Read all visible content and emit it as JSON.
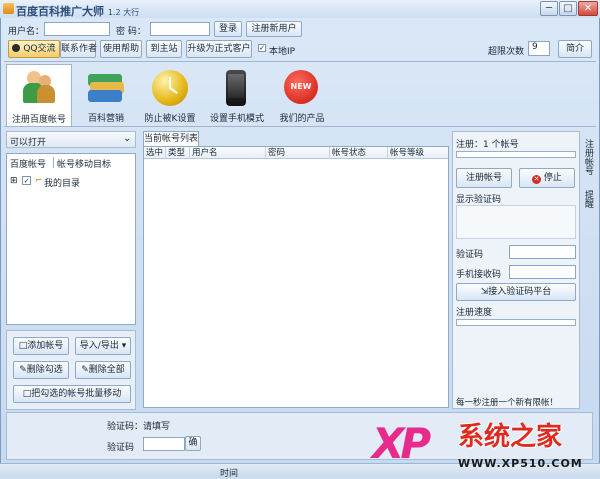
{
  "window": {
    "title": "百度百科推广大师",
    "version": "1.2 大行",
    "buttons": {
      "minimize": "─",
      "maximize": "□",
      "close": "✕"
    }
  },
  "login": {
    "username_label": "用户名：",
    "password_label": "密  码：",
    "login_button": "登录",
    "register_button": "注册新用户"
  },
  "toolbar": {
    "qq_button": "QQ交流",
    "contact_button": "联系作者",
    "help_button": "使用帮助",
    "forum_button": "到主站",
    "upgrade_button": "升级为正式客户",
    "local_checkbox": "本地IP",
    "retry_label": "超限次数",
    "retry_value": "9",
    "about_button": "简介"
  },
  "main_tabs": [
    {
      "label": "注册百度帐号",
      "icon": "user-icon"
    },
    {
      "label": "百科营销",
      "icon": "cards-icon"
    },
    {
      "label": "防止被K设置",
      "icon": "clock-icon"
    },
    {
      "label": "设置手机模式",
      "icon": "phone-icon"
    },
    {
      "label": "我们的产品",
      "icon": "new-badge-icon"
    }
  ],
  "left_panel": {
    "dropdown_value": "可以打开",
    "tab_baidu": "百度帐号",
    "tab_other": "帐号移动目标",
    "tree_root": "我的目录",
    "buttons": {
      "add": "添加帐号",
      "import": "导入/导出",
      "delete_checked": "删除勾选",
      "delete_all": "删除全部",
      "move_checked": "把勾选的帐号批量移动"
    }
  },
  "center_panel": {
    "tab_label": "当前帐号列表",
    "columns": [
      "选中",
      "类型",
      "用户名",
      "密码",
      "帐号状态",
      "帐号等级"
    ]
  },
  "right_panel": {
    "register_label": "注册：",
    "register_count": "1 个帐号",
    "register_button": "注册帐号",
    "stop_button": "停止",
    "captcha_image_label": "显示验证码",
    "captcha_label": "验证码",
    "phone_label": "手机接收码",
    "captcha_tool_button": "接入验证码平台",
    "status_label": "注册速度",
    "notice": "每一秒注册一个新有限帐！",
    "side_tab_register": "注册帐号",
    "side_tab_other": "提醒"
  },
  "bottom": {
    "captcha_status": "验证码：请填写",
    "captcha_label": "验证码",
    "confirm_button": "确"
  },
  "statusbar": {
    "center": "时间"
  },
  "watermark": {
    "brand": "系统之家",
    "letters": "XP",
    "url": "WWW.XP510.COM"
  },
  "colors": {
    "accent": "#2d4d7a",
    "watermark_red": "#e02a1f",
    "watermark_magenta": "#e72a8c"
  }
}
